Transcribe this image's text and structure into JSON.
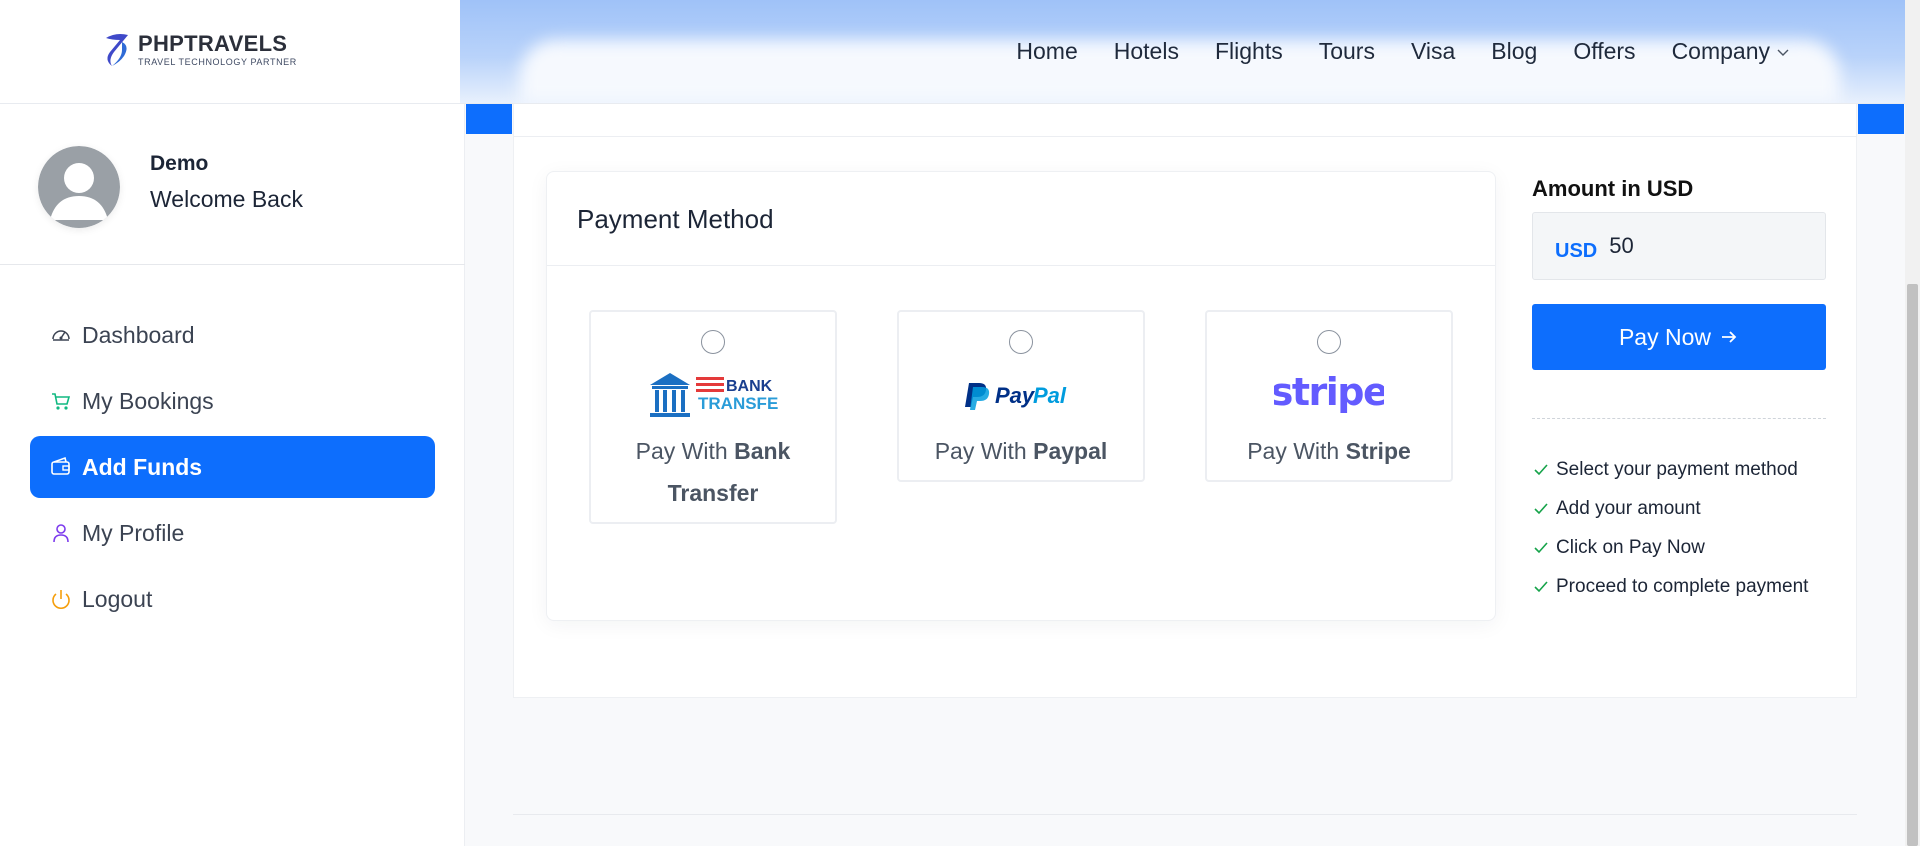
{
  "brand": {
    "name": "PHPTRAVELS",
    "tagline": "TRAVEL TECHNOLOGY PARTNER"
  },
  "nav": [
    {
      "label": "Home"
    },
    {
      "label": "Hotels"
    },
    {
      "label": "Flights"
    },
    {
      "label": "Tours"
    },
    {
      "label": "Visa"
    },
    {
      "label": "Blog"
    },
    {
      "label": "Offers"
    },
    {
      "label": "Company",
      "icon": "chevron-down-icon"
    }
  ],
  "user": {
    "name": "Demo",
    "welcome": "Welcome Back"
  },
  "sidebar": {
    "items": [
      {
        "label": "Dashboard",
        "icon": "speedometer-icon",
        "color": "#3b4352"
      },
      {
        "label": "My Bookings",
        "icon": "cart-icon",
        "color": "#10b981"
      },
      {
        "label": "Add Funds",
        "icon": "wallet-icon",
        "active": true,
        "color": "#ffffff"
      },
      {
        "label": "My Profile",
        "icon": "user-icon",
        "color": "#7c3aed"
      },
      {
        "label": "Logout",
        "icon": "power-icon",
        "color": "#f59e0b"
      }
    ]
  },
  "payment": {
    "title": "Payment Method",
    "options": [
      {
        "prefix": "Pay With ",
        "name": "Bank Transfer",
        "logo_text_1": "BANK",
        "logo_text_2": "TRANSFER"
      },
      {
        "prefix": "Pay With ",
        "name": "Paypal",
        "logo_text": "PayPal"
      },
      {
        "prefix": "Pay With ",
        "name": "Stripe",
        "logo_text": "stripe"
      }
    ]
  },
  "amount": {
    "label": "Amount in USD",
    "currency": "USD",
    "value": "50"
  },
  "pay_button": {
    "label": "Pay Now"
  },
  "steps": [
    "Select your payment method",
    "Add your amount",
    "Click on Pay Now",
    "Proceed to complete payment"
  ],
  "colors": {
    "primary": "#0d6efd",
    "check": "#16a34a",
    "stripe": "#635bff",
    "paypal_dark": "#003087",
    "paypal_light": "#009cde"
  }
}
